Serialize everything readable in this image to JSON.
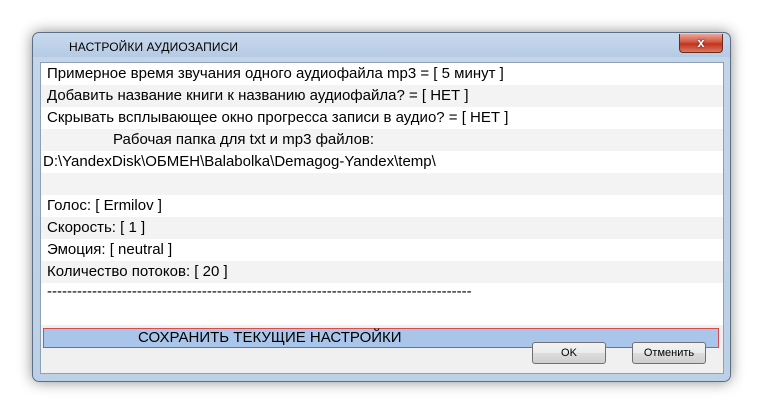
{
  "window": {
    "title": "НАСТРОЙКИ АУДИОЗАПИСИ",
    "close_label": "x"
  },
  "settings_list": {
    "rows": [
      "Примерное время звучания одного аудиофайла mp3 = [ 5 минут ]",
      "Добавить название книги к названию аудиофайла? = [  НЕТ ]",
      "Скрывать всплывающее окно прогресса записи в аудио? = [  НЕТ ]",
      "Рабочая папка для txt и mp3 файлов:",
      "D:\\YandexDisk\\ОБМЕН\\Balabolka\\Demagog-Yandex\\temp\\",
      "",
      "Голос:  [ Ermilov ]",
      "Скорость:  [ 1 ]",
      "Эмоция:  [ neutral ]",
      "Количество потоков:  [ 20 ]",
      "-------------------------------------------------------------------------------------"
    ],
    "save_label": "СОХРАНИТЬ ТЕКУЩИЕ НАСТРОЙКИ"
  },
  "buttons": {
    "ok_label": "OK",
    "cancel_label": "Отменить"
  },
  "colors": {
    "selection": "#a9c6ea",
    "selection_border": "#d94b4b",
    "close_button": "#c2321d"
  }
}
